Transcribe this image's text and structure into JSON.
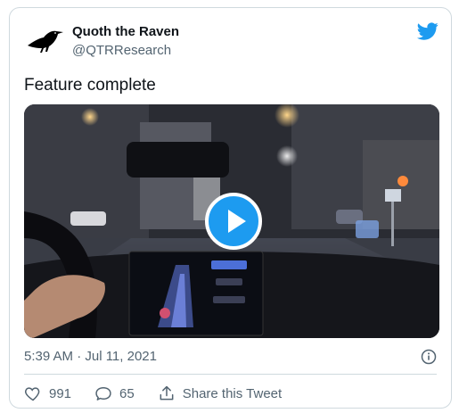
{
  "author": {
    "name": "Quoth the Raven",
    "handle": "@QTRResearch"
  },
  "tweet": {
    "text": "Feature complete",
    "timestamp": "5:39 AM · Jul 11, 2021"
  },
  "stats": {
    "likes": "991",
    "replies": "65",
    "share_label": "Share this Tweet"
  },
  "icons": {
    "brand": "twitter-bird-icon",
    "play": "play-icon",
    "info": "info-icon",
    "like": "heart-icon",
    "reply": "reply-icon",
    "share": "share-icon"
  },
  "colors": {
    "brand": "#1d9bf0",
    "text": "#0f1419",
    "secondary": "#536471",
    "border": "#cfd9de"
  }
}
